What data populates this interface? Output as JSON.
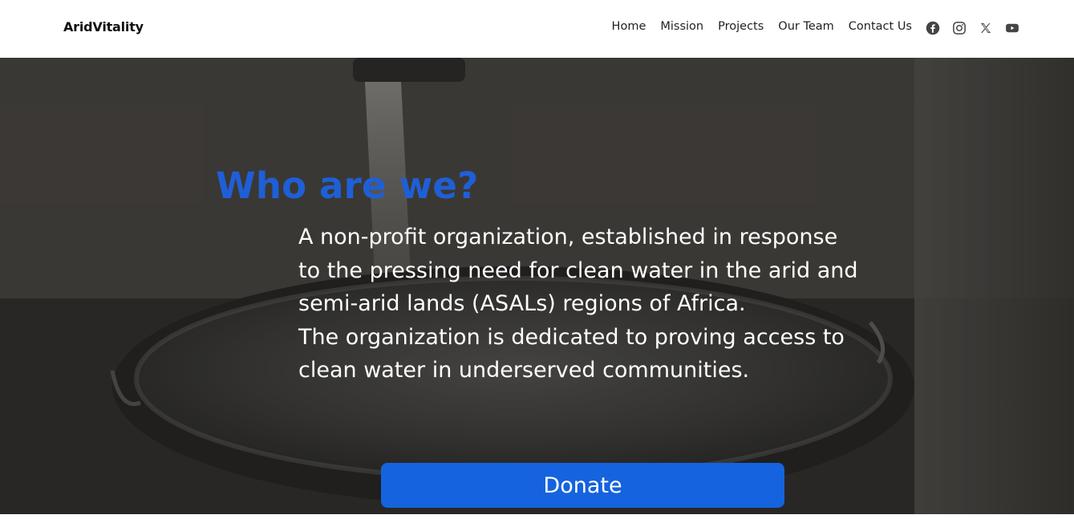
{
  "brand": {
    "name": "AridVitality"
  },
  "nav": {
    "links": [
      {
        "label": "Home"
      },
      {
        "label": "Mission"
      },
      {
        "label": "Projects"
      },
      {
        "label": "Our Team"
      },
      {
        "label": "Contact Us"
      }
    ],
    "social": [
      {
        "icon": "facebook-icon"
      },
      {
        "icon": "instagram-icon"
      },
      {
        "icon": "x-twitter-icon"
      },
      {
        "icon": "youtube-icon"
      }
    ]
  },
  "hero": {
    "title": "Who are we?",
    "paragraph_1": "A non-profit organization, established in response to the pressing need for clean water in the arid and semi-arid lands (ASALs) regions of Africa.",
    "paragraph_2": "The organization is dedicated to proving access to clean water in underserved communities.",
    "donate_label": "Donate"
  },
  "colors": {
    "title_blue": "#1f5fd6",
    "button_blue": "#1563de",
    "icon_gray": "#444444"
  }
}
